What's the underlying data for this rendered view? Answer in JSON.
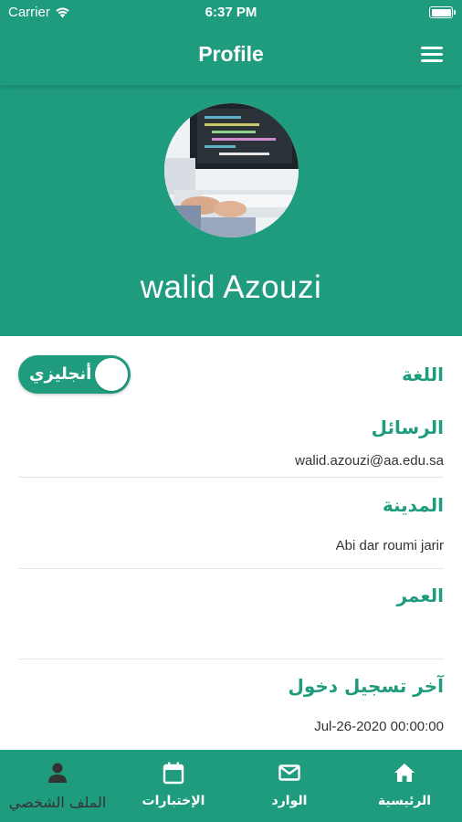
{
  "status_bar": {
    "carrier": "Carrier",
    "time": "6:37 PM"
  },
  "navbar": {
    "title": "Profile",
    "menu_icon": "hamburger-menu-icon"
  },
  "profile": {
    "name": "walid  Azouzi",
    "avatar": "user-avatar-photo"
  },
  "language": {
    "label": "اللغة",
    "toggle_label": "أنجليزي",
    "toggle_on": true
  },
  "messages": {
    "label": "الرسائل",
    "value": "walid.azouzi@aa.edu.sa"
  },
  "city": {
    "label": "المدينة",
    "value": "Abi dar roumi jarir"
  },
  "age": {
    "label": "العمر",
    "value": ""
  },
  "last_login": {
    "label": "آخر تسجيل دخول",
    "value": "Jul-26-2020 00:00:00"
  },
  "tabbar": {
    "accent": "#1f9c7e",
    "tabs": [
      {
        "label": "الملف الشخصي",
        "icon": "person-icon",
        "active": true
      },
      {
        "label": "الإختبارات",
        "icon": "calendar-icon",
        "active": false
      },
      {
        "label": "الوارد",
        "icon": "envelope-icon",
        "active": false
      },
      {
        "label": "الرئيسية",
        "icon": "home-icon",
        "active": false
      }
    ]
  },
  "colors": {
    "primary": "#1f9c7e",
    "text": "#333333",
    "divider": "#e4e4e4"
  }
}
